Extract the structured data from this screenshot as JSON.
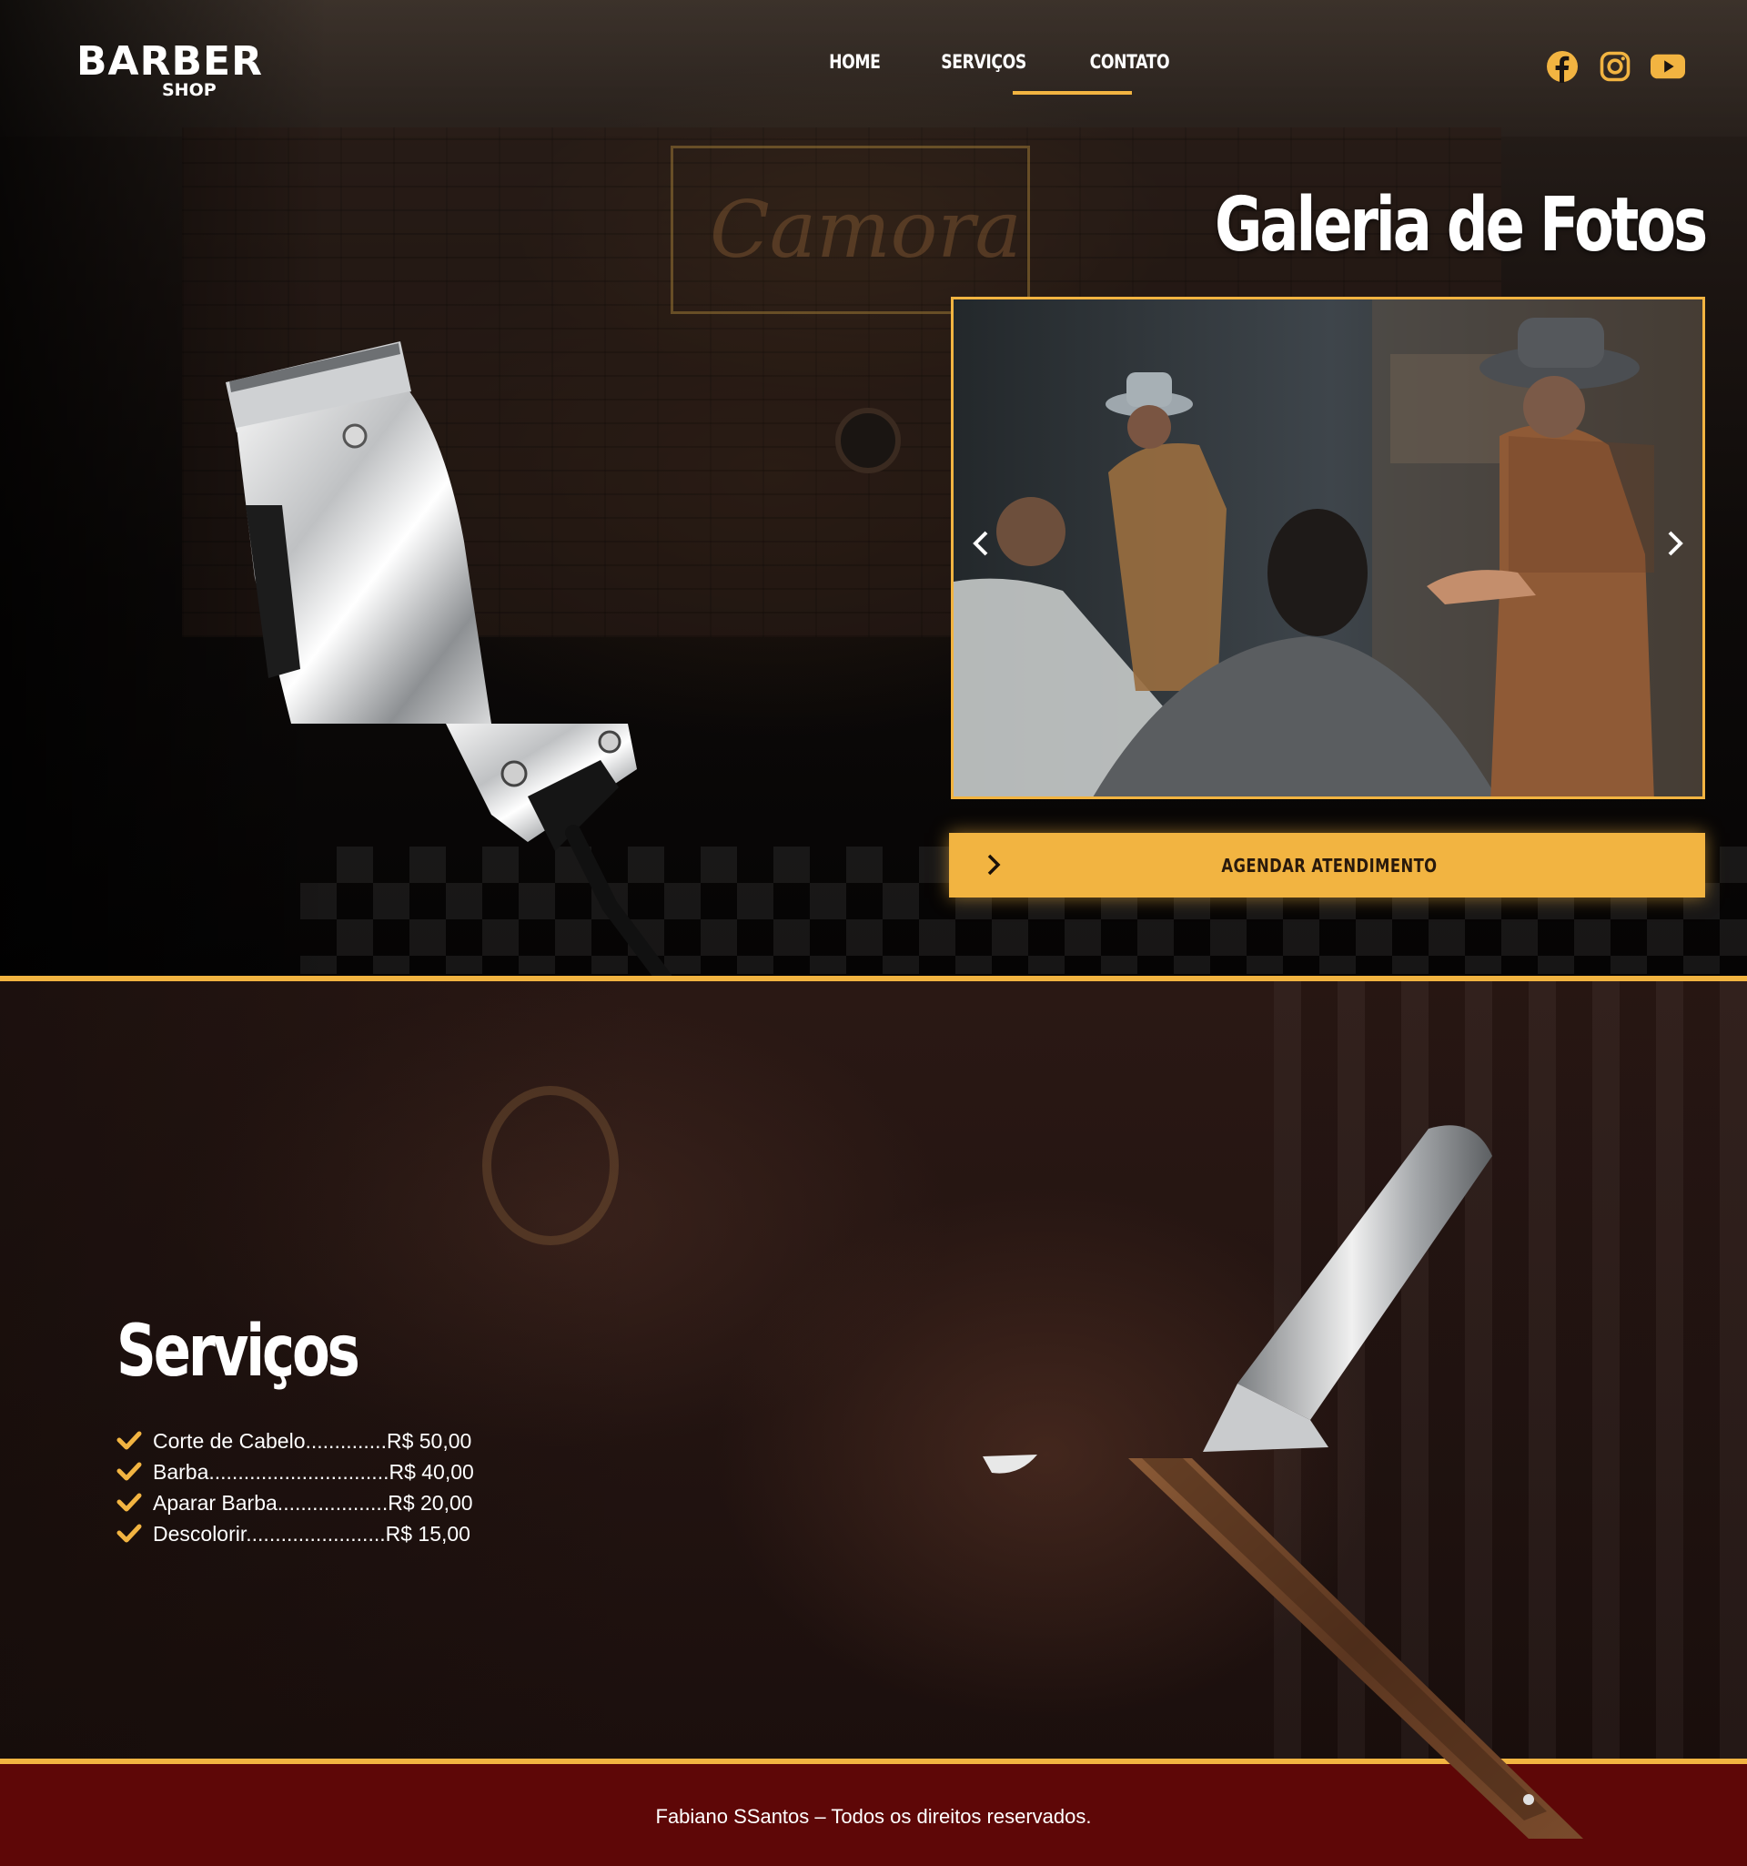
{
  "brand": {
    "logo_text": "BARBER",
    "logo_subtext": "SHOP"
  },
  "nav": {
    "items": [
      {
        "label": "HOME"
      },
      {
        "label": "SERVIÇOS"
      },
      {
        "label": "CONTATO"
      }
    ],
    "active": "CONTATO"
  },
  "social": {
    "icons": [
      "facebook-icon",
      "instagram-icon",
      "youtube-icon"
    ]
  },
  "gallery": {
    "title": "Galeria de Fotos",
    "prev_icon": "chevron-left-icon",
    "next_icon": "chevron-right-icon"
  },
  "cta": {
    "label": "AGENDAR ATENDIMENTO",
    "icon": "chevron-right-icon"
  },
  "services": {
    "title": "Serviços",
    "items": [
      {
        "text": "Corte de Cabelo..............R$ 50,00"
      },
      {
        "text": "Barba...............................R$ 40,00"
      },
      {
        "text": "Aparar Barba...................R$ 20,00"
      },
      {
        "text": "Descolorir........................R$ 15,00"
      }
    ]
  },
  "footer": {
    "text": "Fabiano SSantos – Todos os direitos reservados."
  },
  "colors": {
    "accent": "#f2b441",
    "footer_bg": "#5e0707"
  }
}
